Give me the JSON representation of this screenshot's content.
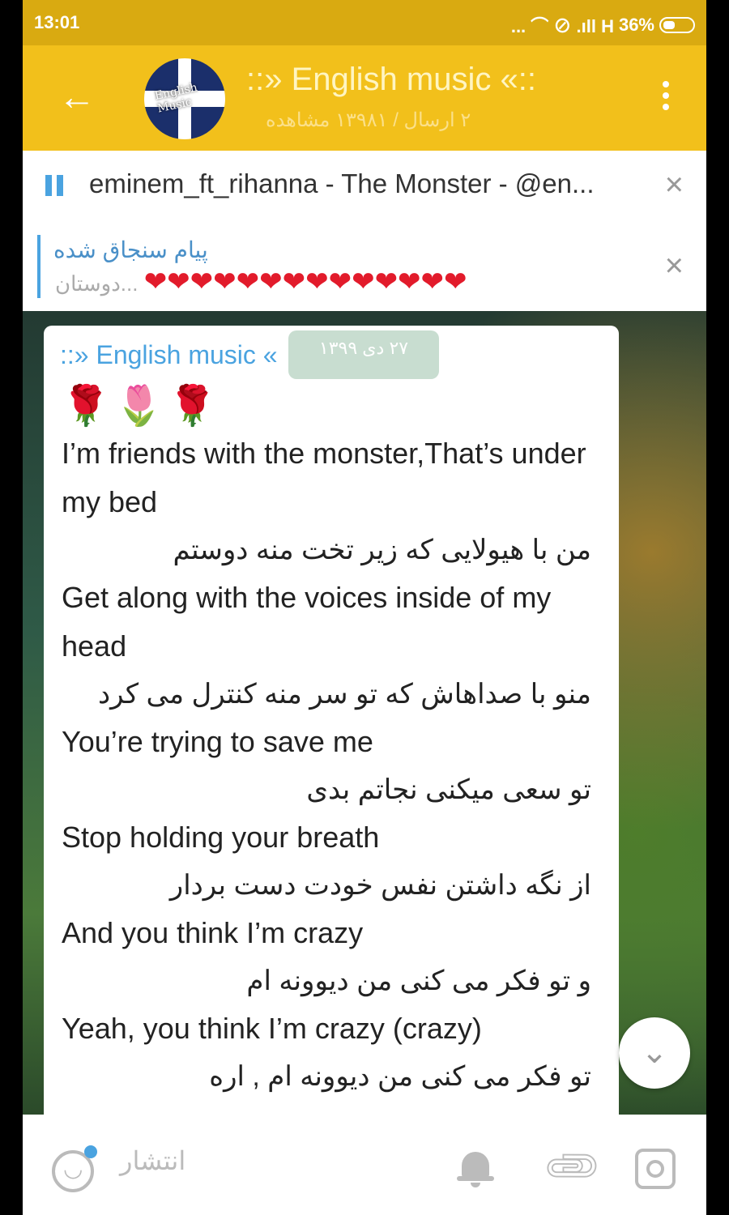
{
  "status_bar": {
    "time": "13:01",
    "indicators": "... ⌒ ⊘ .ıll H",
    "battery": "36%"
  },
  "header": {
    "back_icon": "arrow-left-icon",
    "avatar_text": "English Music",
    "title": "::» English music «::",
    "subtitle": "۲ ارسال / ۱۳۹۸۱ مشاهده"
  },
  "player": {
    "track": "eminem_ft_rihanna - The Monster - @en...",
    "close": "×"
  },
  "pinned": {
    "title": "پیام سنجاق شده",
    "preview": "دوستان...",
    "hearts": "❤❤❤❤❤❤❤❤❤❤❤❤❤❤",
    "close": "×"
  },
  "message": {
    "sender": "::» English music «",
    "date": "۲۷ دی ۱۳۹۹",
    "roses": "🌹🌷🌹",
    "lines": [
      {
        "lang": "en",
        "text": "I’m friends with the monster,That’s under my bed"
      },
      {
        "lang": "fa",
        "text": "من با هیولایی که زیر تخت منه دوستم"
      },
      {
        "lang": "en",
        "text": "Get along with the voices inside of my head"
      },
      {
        "lang": "fa",
        "text": "منو با صداهاش که تو سر منه کنترل می کرد"
      },
      {
        "lang": "en",
        "text": "You’re trying to save me"
      },
      {
        "lang": "fa",
        "text": "تو سعی میکنی نجاتم بدی"
      },
      {
        "lang": "en",
        "text": "Stop holding your breath"
      },
      {
        "lang": "fa",
        "text": "از نگه داشتن نفس خودت دست بردار"
      },
      {
        "lang": "en",
        "text": "And you think I’m crazy"
      },
      {
        "lang": "fa",
        "text": "و تو فکر می کنی من دیوونه ام"
      },
      {
        "lang": "en",
        "text": "Yeah, you think I’m crazy (crazy)"
      },
      {
        "lang": "fa",
        "text": "تو فکر می کنی من دیوونه ام , اره"
      }
    ]
  },
  "scroll_down": "⌄",
  "bottom_bar": {
    "broadcast_label": "انتشار",
    "icons": [
      "emoji-icon",
      "bell-icon",
      "paperclip-icon",
      "camera-icon"
    ]
  },
  "colors": {
    "header": "#f2c01b",
    "accent": "#4aa3e0",
    "heart": "#e21b2b"
  }
}
